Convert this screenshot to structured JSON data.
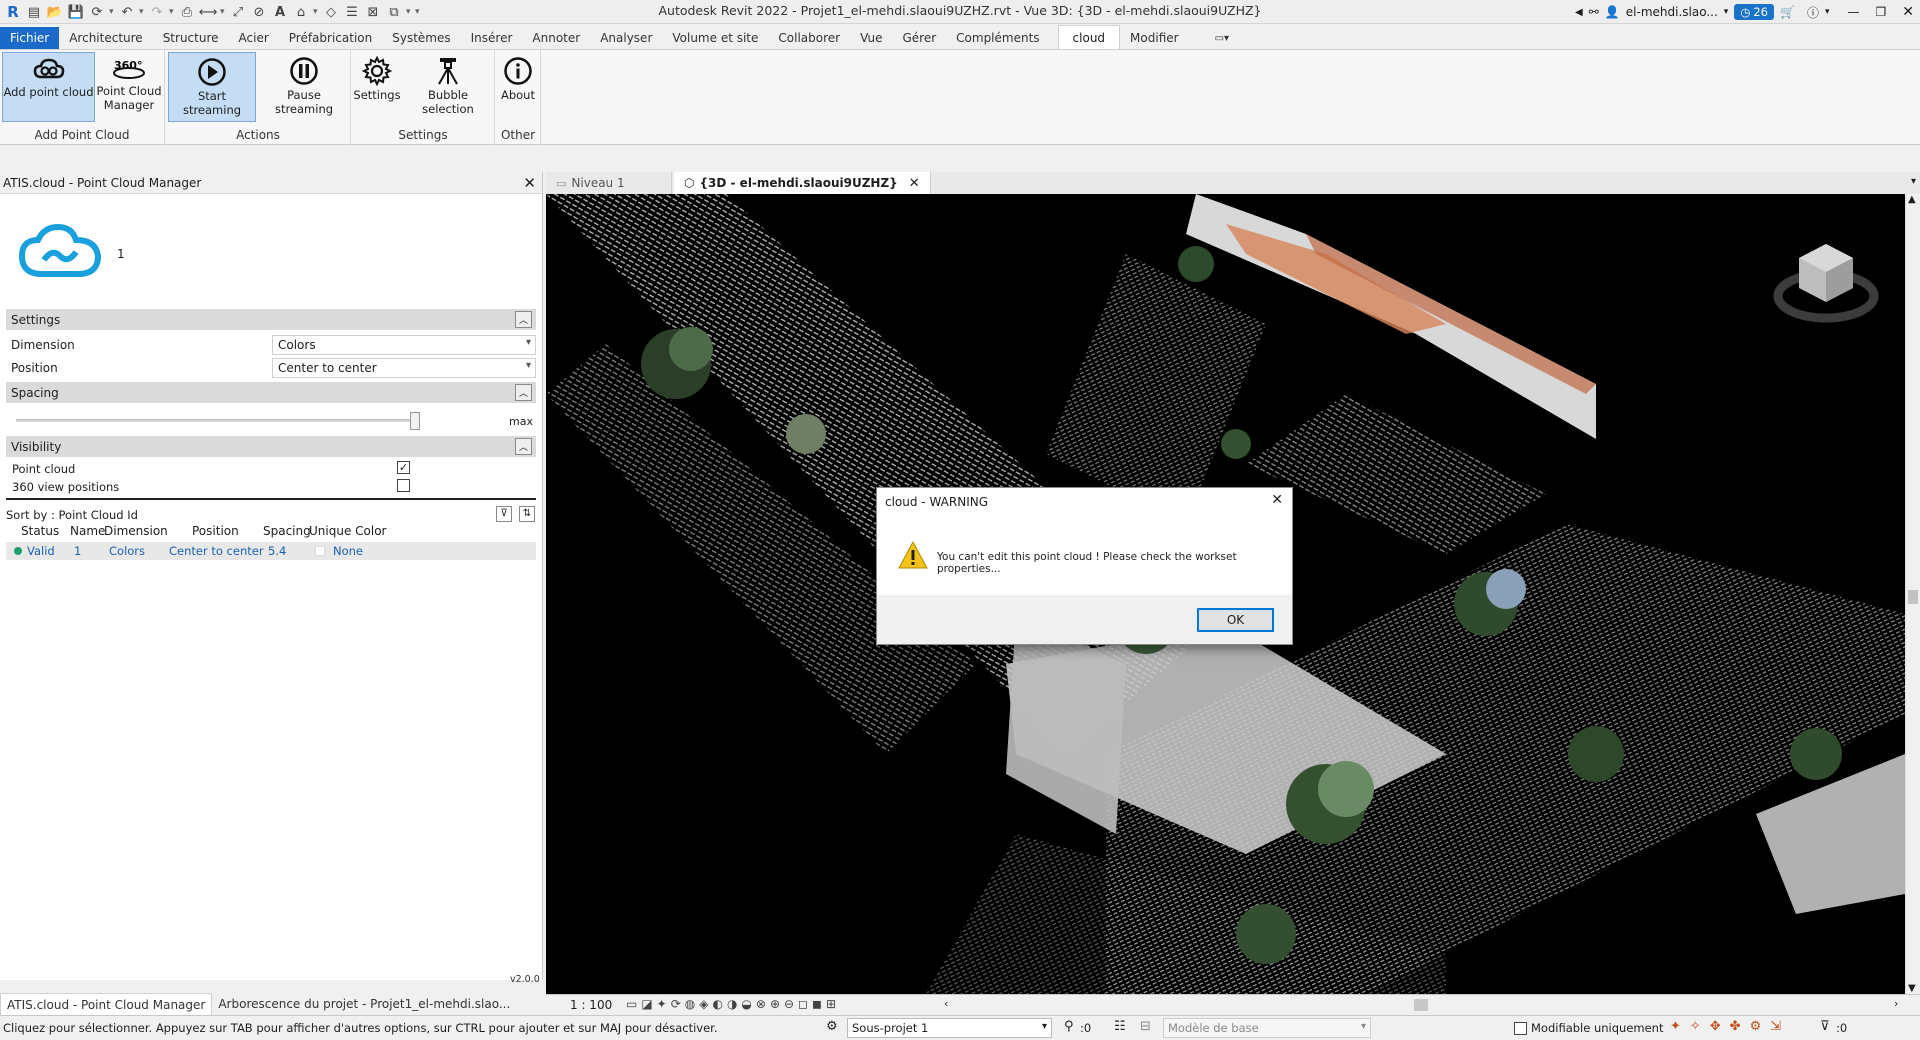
{
  "app": {
    "title": "Autodesk Revit 2022 - Projet1_el-mehdi.slaoui9UZHZ.rvt - Vue 3D: {3D - el-mehdi.slaoui9UZHZ}",
    "user": "el-mehdi.slao...",
    "notif_count": "26"
  },
  "ribbon_tabs": [
    "Fichier",
    "Architecture",
    "Structure",
    "Acier",
    "Préfabrication",
    "Systèmes",
    "Insérer",
    "Annoter",
    "Analyser",
    "Volume et site",
    "Collaborer",
    "Vue",
    "Gérer",
    "Compléments",
    "cloud",
    "Modifier"
  ],
  "ribbon": {
    "groups": {
      "add": "Add Point Cloud",
      "actions": "Actions",
      "settings": "Settings",
      "other": "Other"
    },
    "buttons": {
      "add_point_cloud": "Add point cloud",
      "manager_l1": "Point Cloud",
      "manager_l2": "Manager",
      "start": "Start streaming",
      "pause": "Pause streaming",
      "settings": "Settings",
      "bubble": "Bubble selection",
      "about": "About"
    },
    "icon_360_label": "360°"
  },
  "panel": {
    "title": "ATIS.cloud - Point Cloud Manager",
    "count": "1",
    "settings_header": "Settings",
    "dimension_label": "Dimension",
    "dimension_value": "Colors",
    "position_label": "Position",
    "position_value": "Center to center",
    "spacing_header": "Spacing",
    "spacing_max": "max",
    "visibility_header": "Visibility",
    "point_cloud_label": "Point cloud",
    "view360_label": "360 view positions",
    "sort_label": "Sort by : Point Cloud Id",
    "columns": [
      "Status",
      "Name",
      "Dimension",
      "Position",
      "Spacing",
      "Unique Color"
    ],
    "row": {
      "status": "Valid",
      "name": "1",
      "dimension": "Colors",
      "position": "Center to center",
      "spacing": "5.4",
      "unique_color": "None"
    },
    "version": "v2.0.0"
  },
  "bottom_tabs": [
    "ATIS.cloud - Point Cloud Manager",
    "Arborescence du projet - Projet1_el-mehdi.slao..."
  ],
  "view_tabs": [
    "Niveau 1",
    "{3D - el-mehdi.slaoui9UZHZ}"
  ],
  "view_bar": {
    "scale": "1 : 100"
  },
  "dialog": {
    "title": "cloud - WARNING",
    "message": "You can't edit this point cloud ! Please check the workset properties...",
    "ok": "OK"
  },
  "status": {
    "hint": "Cliquez pour sélectionner. Appuyez sur TAB pour afficher d'autres options, sur CTRL pour ajouter et sur MAJ pour désactiver.",
    "workset": "Sous-projet 1",
    "zero": ":0",
    "model": "Modèle de base",
    "editable_only": "Modifiable uniquement",
    "filter_zero": ":0"
  },
  "colors": {
    "accent": "#1b6ac9",
    "selected": "#c5dcf5",
    "valid": "#1f9e6b",
    "cloud_icon": "#1aa0dc"
  }
}
